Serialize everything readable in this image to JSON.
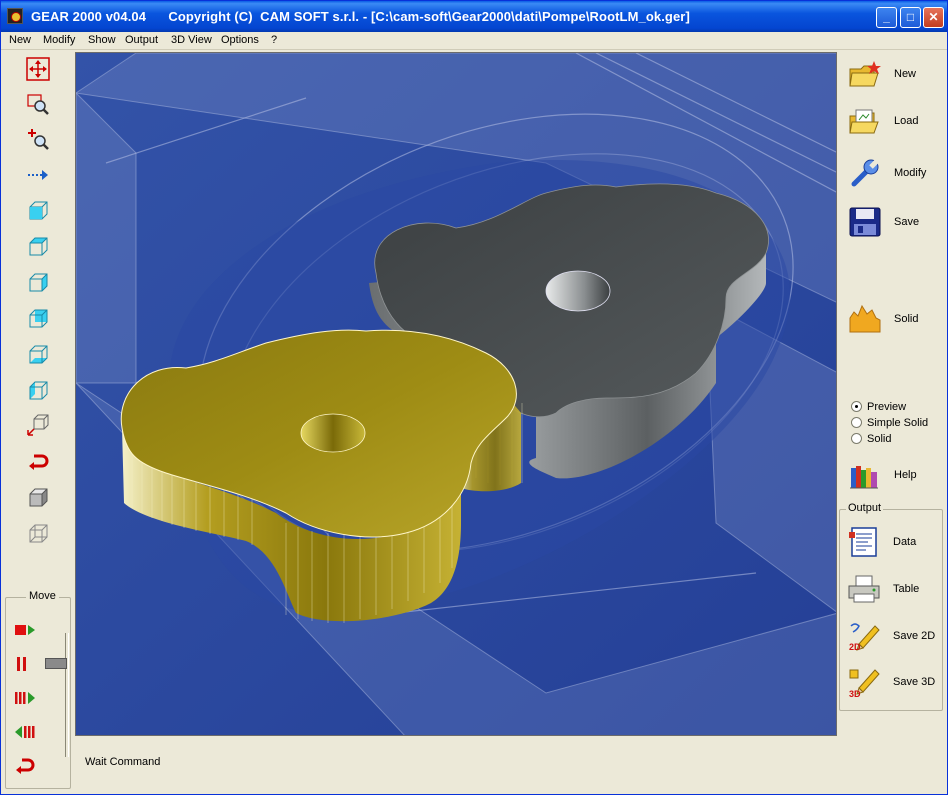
{
  "window": {
    "title": "GEAR 2000 v04.04      Copyright (C)  CAM SOFT s.r.l. - [C:\\cam-soft\\Gear2000\\dati\\Pompe\\RootLM_ok.ger]",
    "min_glyph": "_",
    "max_glyph": "□",
    "close_glyph": "✕"
  },
  "menu": [
    "New",
    "Modify",
    "Show",
    "Output",
    "3D View",
    "Options",
    "?"
  ],
  "left_toolbar": [
    "pan-icon",
    "zoom-window-icon",
    "zoom-in-icon",
    "move-arrow-icon",
    "view-top-icon",
    "view-front-icon",
    "view-side-icon",
    "view-back-icon",
    "view-bottom-icon",
    "view-iso-icon",
    "view-axes-icon",
    "undo-icon",
    "solid-cube-icon",
    "wire-cube-icon"
  ],
  "move_panel": {
    "legend": "Move",
    "slider_value": 0.2,
    "buttons": [
      "play-icon",
      "pause-icon",
      "step-forward-icon",
      "step-back-icon",
      "return-icon"
    ]
  },
  "status_text": "Wait Command",
  "right_panel": {
    "new_label": "New",
    "load_label": "Load",
    "modify_label": "Modify",
    "save_label": "Save",
    "solid_label": "Solid",
    "help_label": "Help",
    "render_mode": {
      "options": [
        "Preview",
        "Simple Solid",
        "Solid"
      ],
      "selected": "Preview"
    }
  },
  "output_panel": {
    "legend": "Output",
    "data_label": "Data",
    "table_label": "Table",
    "save2d_label": "Save 2D",
    "save3d_label": "Save 3D",
    "icon_2d_text": "2D",
    "icon_3d_text": "3D"
  },
  "colors": {
    "viewport_bg": "#2b4aa0",
    "gear_gold": "#a89416",
    "gear_gray": "#4a4e50",
    "title_blue": "#0a55de"
  }
}
